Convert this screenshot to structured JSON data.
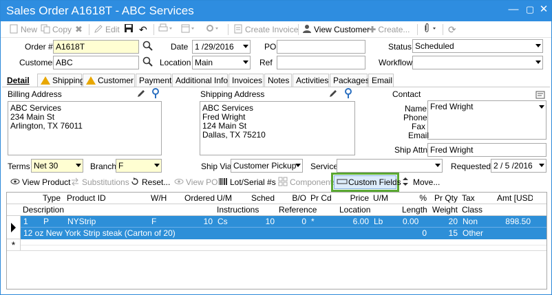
{
  "window": {
    "title": "Sales Order A1618T - ABC Services"
  },
  "toolbar": {
    "new": "New",
    "copy": "Copy",
    "edit": "Edit",
    "create_invoice": "Create Invoice",
    "view_customer": "View Customer",
    "create": "Create..."
  },
  "form": {
    "order_label": "Order #",
    "order_value": "A1618T",
    "date_label": "Date",
    "date_value": "1 /29/2016",
    "po_label": "PO",
    "po_value": "",
    "status_label": "Status",
    "status_value": "Scheduled",
    "customer_label": "Customer",
    "customer_value": "ABC",
    "location_label": "Location",
    "location_value": "Main",
    "ref_label": "Ref",
    "ref_value": "",
    "workflow_label": "Workflow",
    "workflow_value": ""
  },
  "tabs": [
    "Detail",
    "Shipping",
    "Customer",
    "Payment",
    "Additional Info",
    "Invoices",
    "Notes",
    "Activities",
    "Packages",
    "Email"
  ],
  "detail": {
    "billing_label": "Billing Address",
    "billing_lines": [
      "ABC Services",
      "234 Main St",
      "Arlington, TX 76011"
    ],
    "shipping_label": "Shipping Address",
    "shipping_lines": [
      "ABC Services",
      "Fred Wright",
      "124 Main St",
      "Dallas, TX 75210"
    ],
    "contact_label": "Contact",
    "name_label": "Name",
    "name_value": "Fred Wright",
    "phone_label": "Phone",
    "fax_label": "Fax",
    "email_label": "Email",
    "shipattn_label": "Ship Attn",
    "shipattn_value": "Fred Wright",
    "terms_label": "Terms",
    "terms_value": "Net 30",
    "branch_label": "Branch",
    "branch_value": "F",
    "shipvia_label": "Ship Via",
    "shipvia_value": "Customer Pickup",
    "service_label": "Service",
    "service_value": "",
    "requested_label": "Requested",
    "requested_value": "2 / 5 /2016"
  },
  "actions": {
    "view_product": "View Product",
    "substitutions": "Substitutions",
    "reset": "Reset...",
    "view_po": "View PO",
    "lot_serial": "Lot/Serial #s",
    "components": "Components",
    "custom_fields": "Custom Fields",
    "move": "Move..."
  },
  "grid": {
    "header1": [
      "Type",
      "Product ID",
      "W/H",
      "Ordered",
      "U/M",
      "Sched",
      "B/O",
      "Pr Cd",
      "Price",
      "U/M",
      "%",
      "Pr Qty",
      "Tax",
      "Amt [USD]"
    ],
    "header2": [
      "Description",
      "Instructions",
      "Reference",
      "Location",
      "Length",
      "Weight",
      "Class"
    ],
    "row1": [
      "1",
      "P",
      "NYStrip",
      "F",
      "10",
      "Cs",
      "10",
      "0",
      "*",
      "6.00",
      "Lb",
      "0.00",
      "20",
      "Non",
      "898.50"
    ],
    "row2": [
      "12 oz New York Strip steak (Carton of 20)",
      "0",
      "15",
      "Other"
    ],
    "new_row_marker": "*"
  },
  "colors": {
    "titlebar": "#2e8de0",
    "selection": "#2d8fd8",
    "highlight": "#5aa832",
    "required": "#fffed2"
  }
}
